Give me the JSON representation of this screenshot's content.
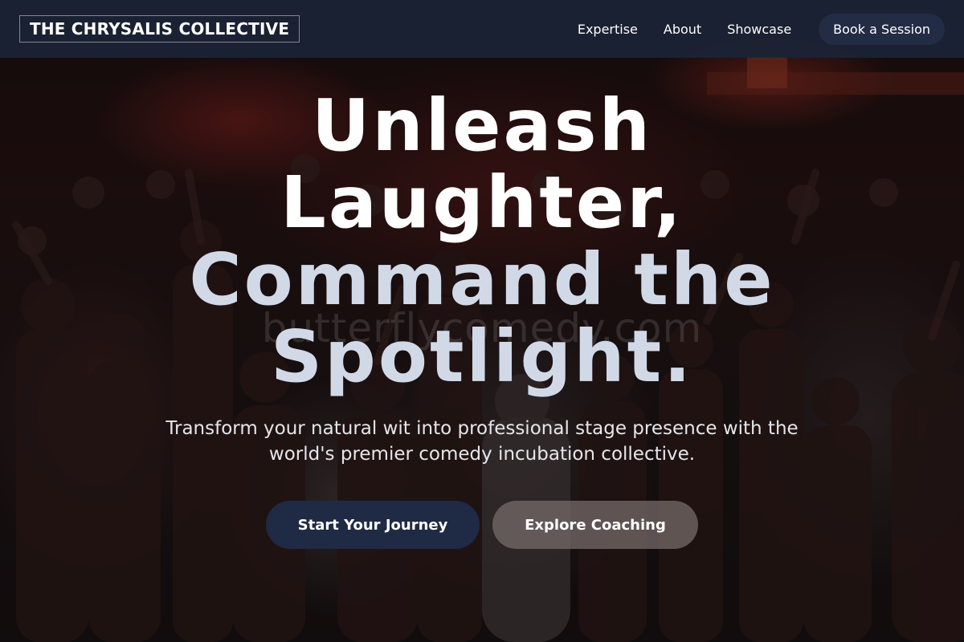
{
  "header": {
    "logo": "THE CHRYSALIS COLLECTIVE",
    "nav": [
      "Expertise",
      "About",
      "Showcase"
    ],
    "cta": "Book a Session"
  },
  "hero": {
    "headline_white": [
      "Unleash",
      "Laughter,"
    ],
    "headline_blue": [
      "Command the",
      "Spotlight."
    ],
    "subheadline": "Transform your natural wit into professional stage presence with the world's premier comedy incubation collective.",
    "primary_button": "Start Your Journey",
    "secondary_button": "Explore Coaching",
    "watermark": "butterflycomedy.com"
  },
  "colors": {
    "header_bg": "#1b2436",
    "primary_button": "#1f2a45",
    "headline_accent": "#d1d9e7"
  }
}
